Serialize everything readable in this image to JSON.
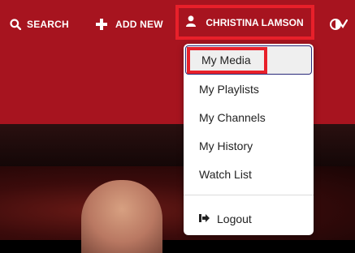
{
  "header": {
    "search_label": "SEARCH",
    "add_new_label": "ADD NEW",
    "user_name": "CHRISTINA LAMSON",
    "accent_color": "#a7141f",
    "highlight_color": "#e8202a"
  },
  "user_menu": {
    "items": [
      {
        "label": "My Media"
      },
      {
        "label": "My Playlists"
      },
      {
        "label": "My Channels"
      },
      {
        "label": "My History"
      },
      {
        "label": "Watch List"
      }
    ],
    "logout_label": "Logout"
  },
  "icons": {
    "search": "search-icon",
    "add": "plus-icon",
    "user": "user-icon",
    "accessibility": "contrast-toggle-icon",
    "logout": "logout-icon"
  }
}
